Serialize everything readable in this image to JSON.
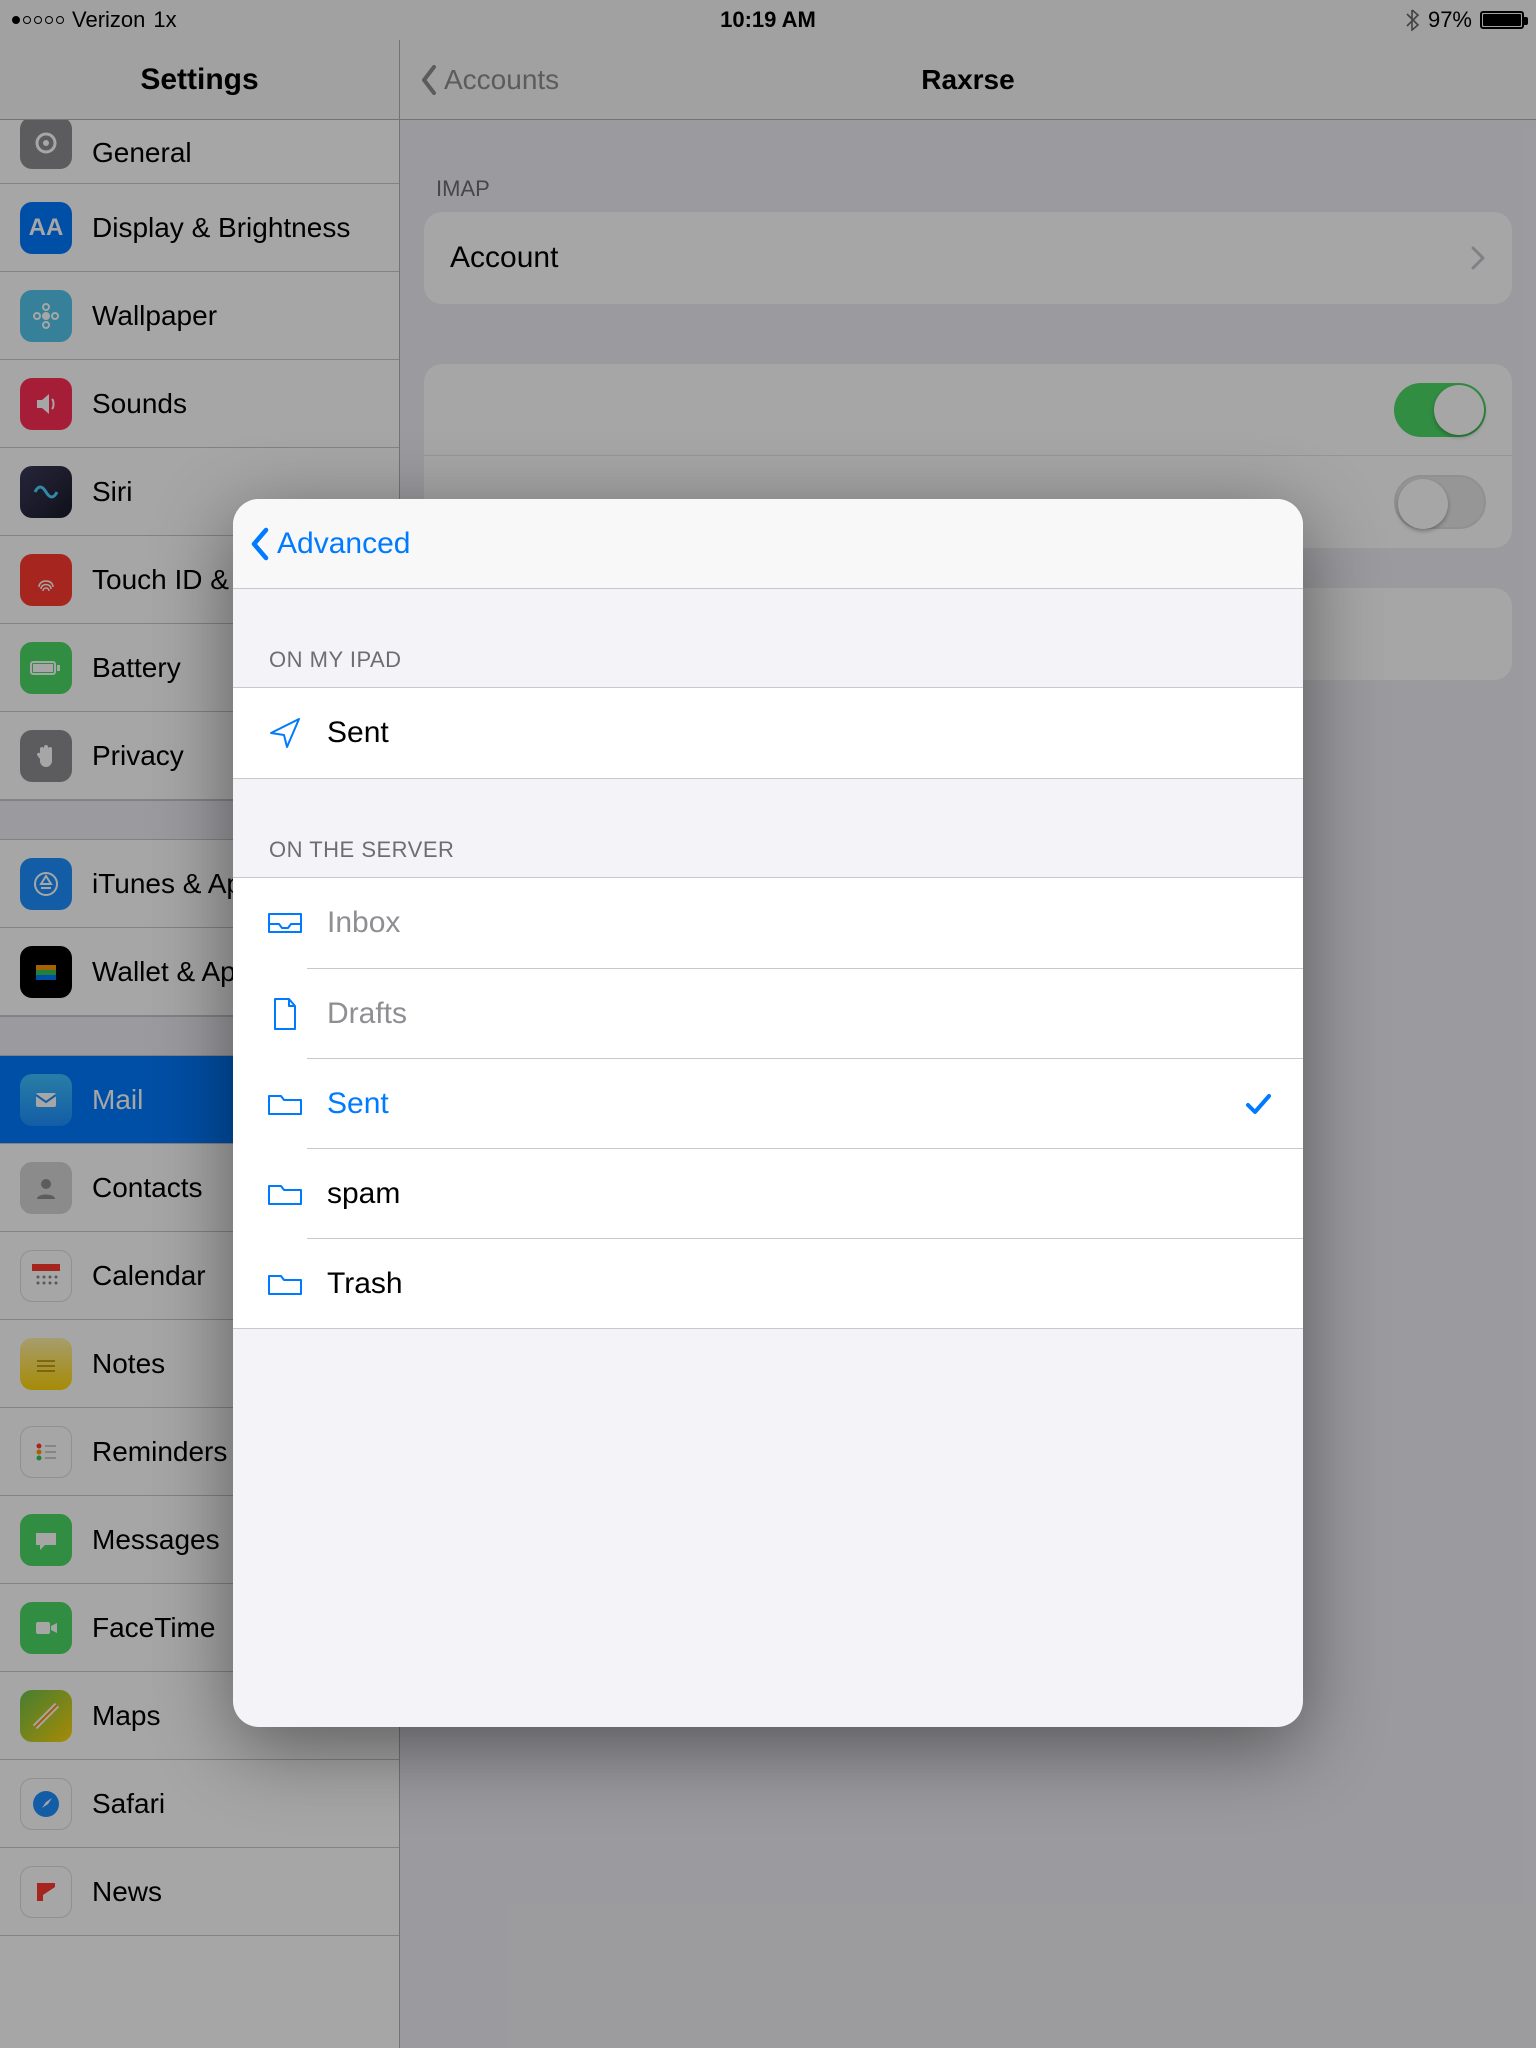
{
  "status": {
    "carrier": "Verizon",
    "network": "1x",
    "time": "10:19 AM",
    "battery_pct": "97%"
  },
  "nav": {
    "settings_title": "Settings",
    "back_label": "Accounts",
    "detail_title": "Raxrse"
  },
  "sidebar": {
    "items": [
      {
        "label": "General",
        "icon": "gear",
        "color": "#8e8e93"
      },
      {
        "label": "Display & Brightness",
        "icon": "aa",
        "color": "#007aff"
      },
      {
        "label": "Wallpaper",
        "icon": "flower",
        "color": "#54c7ec"
      },
      {
        "label": "Sounds",
        "icon": "sound",
        "color": "#ff3b30"
      },
      {
        "label": "Siri",
        "icon": "siri",
        "color": "#222"
      },
      {
        "label": "Touch ID & Passcode",
        "icon": "finger",
        "color": "#ff3b30"
      },
      {
        "label": "Battery",
        "icon": "battery",
        "color": "#4cd964"
      },
      {
        "label": "Privacy",
        "icon": "hand",
        "color": "#8e8e93"
      }
    ],
    "items2": [
      {
        "label": "iTunes & App Store",
        "icon": "appstore",
        "color": "#1e90ff"
      },
      {
        "label": "Wallet & Apple Pay",
        "icon": "wallet",
        "color": "#000"
      }
    ],
    "items3": [
      {
        "label": "Mail",
        "icon": "mail",
        "color": "#1e90ff",
        "selected": true
      },
      {
        "label": "Contacts",
        "icon": "contacts",
        "color": "#8e8e93"
      },
      {
        "label": "Calendar",
        "icon": "calendar",
        "color": "#fff"
      },
      {
        "label": "Notes",
        "icon": "notes",
        "color": "#ffd60a"
      },
      {
        "label": "Reminders",
        "icon": "reminders",
        "color": "#fff"
      },
      {
        "label": "Messages",
        "icon": "messages",
        "color": "#4cd964"
      },
      {
        "label": "FaceTime",
        "icon": "facetime",
        "color": "#4cd964"
      },
      {
        "label": "Maps",
        "icon": "maps",
        "color": "#6cc24a"
      },
      {
        "label": "Safari",
        "icon": "safari",
        "color": "#1e90ff"
      },
      {
        "label": "News",
        "icon": "news",
        "color": "#ff3b30"
      }
    ]
  },
  "detail": {
    "section1_header": "IMAP",
    "account_label": "Account",
    "toggle1_on": true,
    "toggle2_on": false
  },
  "popover": {
    "back_label": "Advanced",
    "section1_header": "ON MY IPAD",
    "local_items": [
      {
        "label": "Sent",
        "icon": "send"
      }
    ],
    "section2_header": "ON THE SERVER",
    "server_items": [
      {
        "label": "Inbox",
        "icon": "inbox",
        "muted": true
      },
      {
        "label": "Drafts",
        "icon": "file",
        "muted": true
      },
      {
        "label": "Sent",
        "icon": "folder",
        "accent": true,
        "checked": true
      },
      {
        "label": "spam",
        "icon": "folder"
      },
      {
        "label": "Trash",
        "icon": "folder"
      }
    ]
  }
}
